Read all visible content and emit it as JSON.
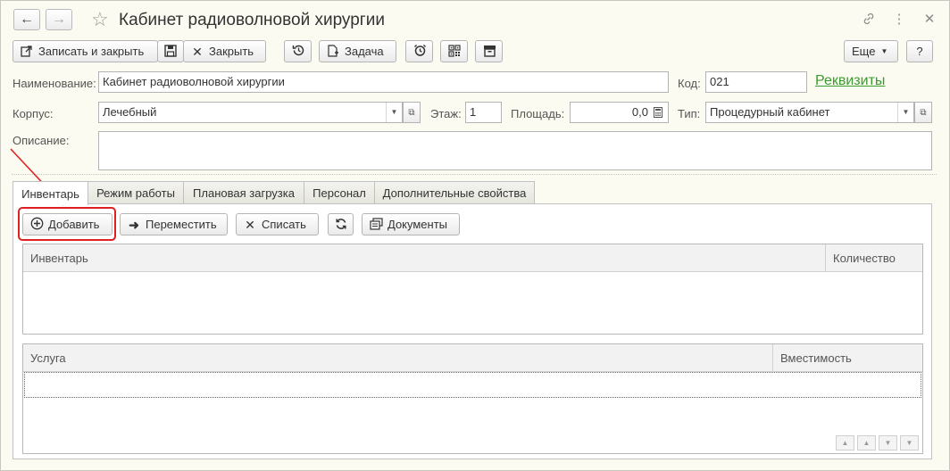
{
  "window": {
    "title": "Кабинет радиоволновой хирургии"
  },
  "toolbar": {
    "save_close_label": "Записать и закрыть",
    "close_label": "Закрыть",
    "task_label": "Задача",
    "more_label": "Еще",
    "help_label": "?"
  },
  "form": {
    "name_label": "Наименование:",
    "name_value": "Кабинет радиоволновой хирургии",
    "code_label": "Код:",
    "code_value": "021",
    "requisites_link": "Реквизиты",
    "building_label": "Корпус:",
    "building_value": "Лечебный",
    "floor_label": "Этаж:",
    "floor_value": "1",
    "area_label": "Площадь:",
    "area_value": "0,0",
    "type_label": "Тип:",
    "type_value": "Процедурный кабинет",
    "description_label": "Описание:",
    "description_value": ""
  },
  "tabs": [
    {
      "label": "Инвентарь"
    },
    {
      "label": "Режим работы"
    },
    {
      "label": "Плановая загрузка"
    },
    {
      "label": "Персонал"
    },
    {
      "label": "Дополнительные свойства"
    }
  ],
  "inventory_toolbar": {
    "add_label": "Добавить",
    "move_label": "Переместить",
    "write_off_label": "Списать",
    "documents_label": "Документы"
  },
  "inventory_table": {
    "columns": [
      "Инвентарь",
      "Количество"
    ]
  },
  "services_table": {
    "columns": [
      "Услуга",
      "Вместимость"
    ]
  },
  "colors": {
    "link": "#3a9b2e",
    "highlight": "#e02020",
    "window_bg": "#fbfbf1"
  }
}
